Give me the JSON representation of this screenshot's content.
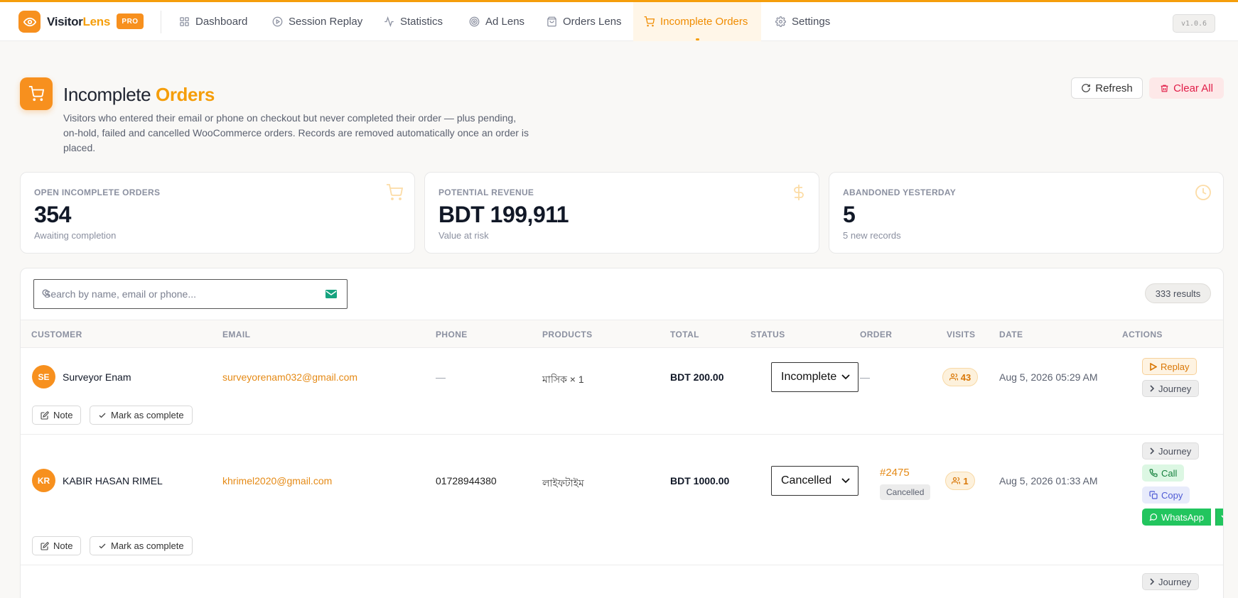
{
  "app": {
    "name_part1": "Visitor",
    "name_part2": "Lens",
    "badge": "PRO",
    "version": "v1.0.6"
  },
  "nav": [
    {
      "label": "Dashboard",
      "icon": "grid-icon"
    },
    {
      "label": "Session Replay",
      "icon": "play-circle-icon"
    },
    {
      "label": "Statistics",
      "icon": "activity-icon"
    },
    {
      "label": "Ad Lens",
      "icon": "target-icon"
    },
    {
      "label": "Orders Lens",
      "icon": "bag-icon"
    },
    {
      "label": "Incomplete Orders",
      "icon": "cart-icon",
      "active": true
    },
    {
      "label": "Settings",
      "icon": "gear-icon"
    }
  ],
  "page": {
    "title_part1": "Incomplete",
    "title_part2": "Orders",
    "description": "Visitors who entered their email or phone on checkout but never completed their order — plus pending, on-hold, failed and cancelled WooCommerce orders. Records are removed automatically once an order is placed.",
    "refresh_label": "Refresh",
    "clear_label": "Clear All"
  },
  "stats": [
    {
      "label": "OPEN INCOMPLETE ORDERS",
      "value": "354",
      "sub": "Awaiting completion",
      "icon": "cart-icon"
    },
    {
      "label": "POTENTIAL REVENUE",
      "value": "BDT 199,911",
      "sub": "Value at risk",
      "icon": "dollar-icon"
    },
    {
      "label": "ABANDONED YESTERDAY",
      "value": "5",
      "sub": "5 new records",
      "icon": "clock-icon"
    }
  ],
  "search": {
    "placeholder": "Search by name, email or phone...",
    "results": "333 results"
  },
  "columns": [
    "CUSTOMER",
    "EMAIL",
    "PHONE",
    "PRODUCTS",
    "TOTAL",
    "STATUS",
    "ORDER",
    "VISITS",
    "DATE",
    "ACTIONS"
  ],
  "rows": [
    {
      "initials": "SE",
      "name": "Surveyor Enam",
      "email": "surveyorenam032@gmail.com",
      "phone": "—",
      "products": "মাসিক × 1",
      "total": "BDT 200.00",
      "status": "Incomplete",
      "order": "—",
      "visits": "43",
      "date": "Aug 5, 2026 05:29 AM",
      "actions": {
        "replay": "Replay",
        "journey": "Journey"
      },
      "note": "Note",
      "mark": "Mark as complete"
    },
    {
      "initials": "KR",
      "name": "KABIR HASAN RIMEL",
      "email": "khrimel2020@gmail.com",
      "phone": "01728944380",
      "products": "লাইফটাইম",
      "total": "BDT 1000.00",
      "status": "Cancelled",
      "order": "#2475",
      "order_status": "Cancelled",
      "visits": "1",
      "date": "Aug 5, 2026 01:33 AM",
      "actions": {
        "journey": "Journey",
        "call": "Call",
        "copy": "Copy",
        "whatsapp": "WhatsApp"
      },
      "note": "Note",
      "mark": "Mark as complete"
    },
    {
      "actions": {
        "journey": "Journey"
      }
    }
  ],
  "colors": {
    "accent": "#f59e0b",
    "brand": "#f7901e",
    "danger": "#e11d48",
    "success": "#22c55e"
  }
}
